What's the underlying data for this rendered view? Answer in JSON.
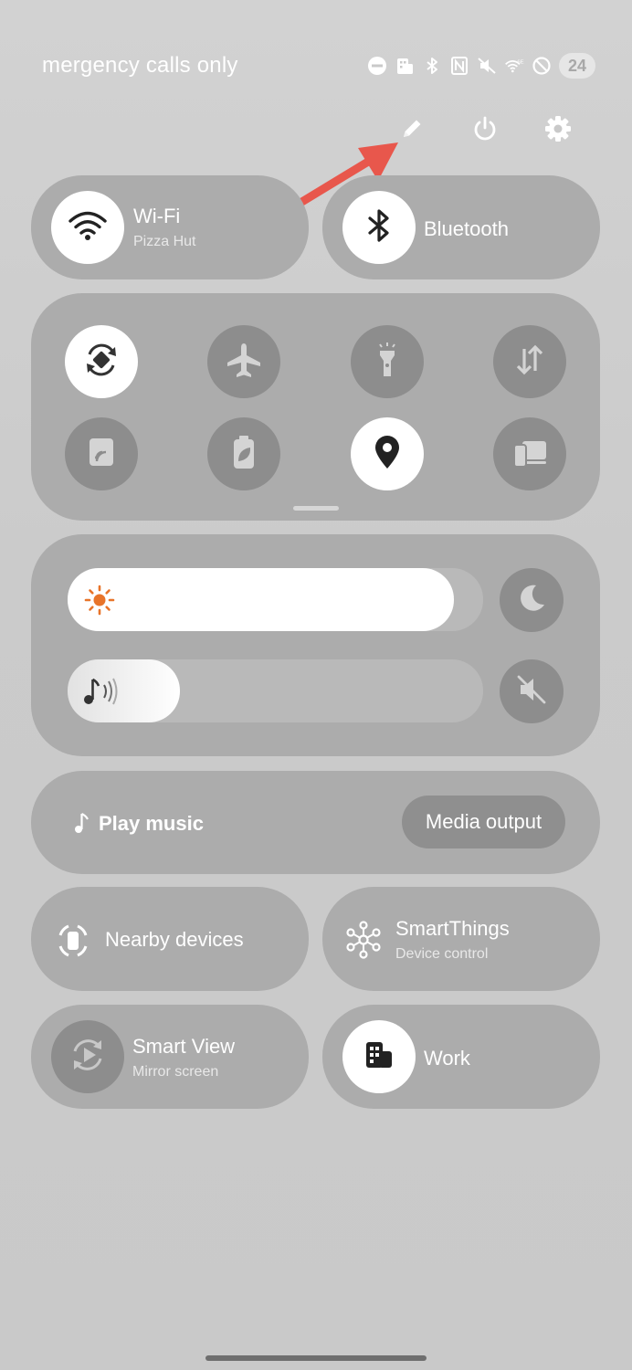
{
  "status_bar": {
    "carrier_text": "mergency calls only",
    "battery": "24",
    "icons": [
      "dnd-icon",
      "work-profile-icon",
      "bluetooth-icon",
      "nfc-icon",
      "mute-icon",
      "wifi-6e-icon",
      "data-saver-icon",
      "battery-icon"
    ]
  },
  "header_buttons": [
    "edit-pencil-icon",
    "power-icon",
    "settings-gear-icon"
  ],
  "tiles": {
    "wifi": {
      "title": "Wi-Fi",
      "subtitle": "Pizza Hut"
    },
    "bluetooth": {
      "title": "Bluetooth"
    },
    "nearby": {
      "title": "Nearby devices"
    },
    "smartthings": {
      "title": "SmartThings",
      "subtitle": "Device control"
    },
    "smart_view": {
      "title": "Smart View",
      "subtitle": "Mirror screen"
    },
    "work": {
      "title": "Work"
    }
  },
  "quick_toggles": [
    {
      "name": "auto-rotate",
      "active": true
    },
    {
      "name": "airplane-mode",
      "active": false
    },
    {
      "name": "flashlight",
      "active": false
    },
    {
      "name": "mobile-data",
      "active": false
    },
    {
      "name": "nfc",
      "active": false
    },
    {
      "name": "power-saving",
      "active": false
    },
    {
      "name": "location",
      "active": true
    },
    {
      "name": "dex",
      "active": false
    }
  ],
  "sliders": {
    "brightness_level": 0.93,
    "volume_level": 0.27
  },
  "media": {
    "play_label": "Play music",
    "output_label": "Media output"
  },
  "colors": {
    "accent_arrow": "#e8574c",
    "sun": "#e8742a"
  }
}
